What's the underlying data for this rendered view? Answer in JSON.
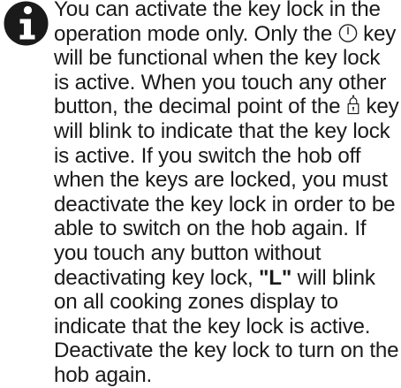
{
  "note": {
    "icon": "info-icon",
    "segments": [
      "You can activate the key lock in the operation mode only. Only the ",
      "key will be functional when the key lock is active. When you touch any other button, the decimal point of the ",
      "key will blink to indicate that the key lock is active. If you switch the hob off when the keys are locked, you must deactivate the key lock in order to be able to switch on the hob again. If you touch any button without deactivating key lock, ",
      "\"L\"",
      " will blink on all cooking zones display to indicate that the key lock is active. Deactivate the key lock to turn on the hob again."
    ],
    "inline_icons": [
      "power-icon",
      "lock-icon"
    ],
    "text_color": "#1a1a1a",
    "icon_color": "#1a1a1a"
  }
}
